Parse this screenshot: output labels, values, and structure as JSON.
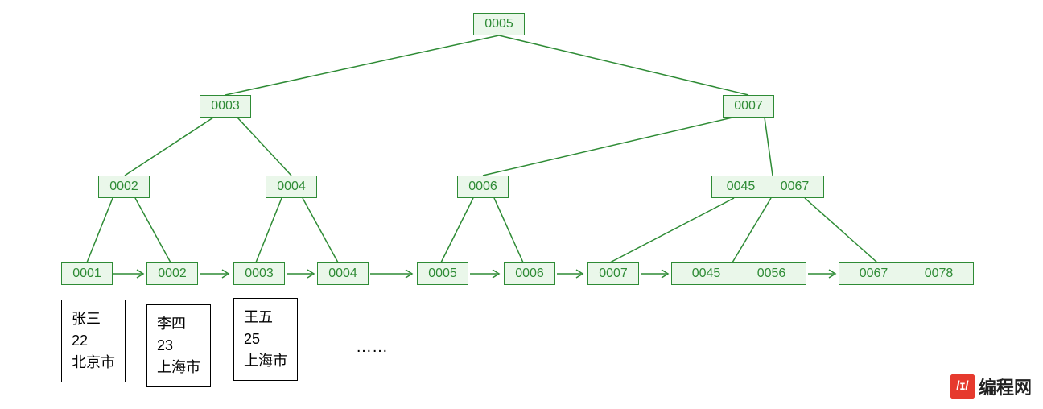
{
  "tree": {
    "root": "0005",
    "l2_left": "0003",
    "l2_right": "0007",
    "l3_a": "0002",
    "l3_b": "0004",
    "l3_c": "0006",
    "l3_d_1": "0045",
    "l3_d_2": "0067",
    "leaf1": "0001",
    "leaf2": "0002",
    "leaf3": "0003",
    "leaf4": "0004",
    "leaf5": "0005",
    "leaf6": "0006",
    "leaf7": "0007",
    "leaf8_1": "0045",
    "leaf8_2": "0056",
    "leaf9_1": "0067",
    "leaf9_2": "0078"
  },
  "data_records": {
    "r1": {
      "name": "张三",
      "age": "22",
      "city": "北京市"
    },
    "r2": {
      "name": "李四",
      "age": "23",
      "city": "上海市"
    },
    "r3": {
      "name": "王五",
      "age": "25",
      "city": "上海市"
    }
  },
  "ellipsis": "……",
  "branding": {
    "icon": "/ɪ/",
    "text": "编程网"
  }
}
